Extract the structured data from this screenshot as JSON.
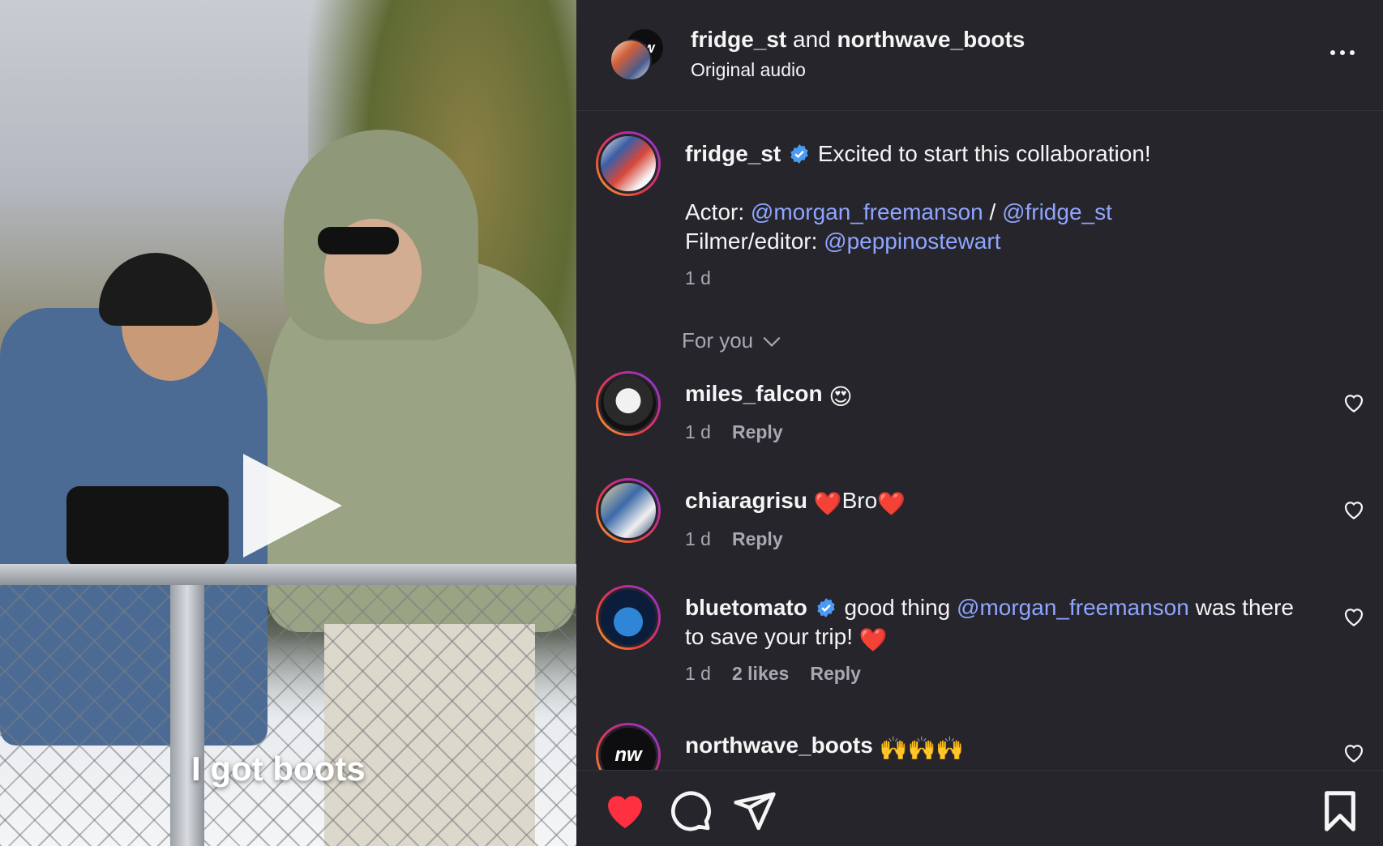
{
  "video": {
    "caption": "I got boots"
  },
  "header": {
    "author1": "fridge_st",
    "conjunction": " and ",
    "author2": "northwave_boots",
    "subtitle": "Original audio",
    "nw_badge": "nw"
  },
  "post": {
    "author": "fridge_st",
    "text": "Excited to start this collaboration!",
    "credit1_label": "Actor: ",
    "credit1_mention_a": "@morgan_freemanson",
    "credit1_sep": " / ",
    "credit1_mention_b": "@fridge_st",
    "credit2_label": "Filmer/editor: ",
    "credit2_mention": "@peppinostewart",
    "time": "1 d"
  },
  "sort": {
    "label": "For you"
  },
  "comments": [
    {
      "username": "miles_falcon",
      "text": "",
      "emoji": "😍",
      "time": "1 d",
      "likes": "",
      "reply": "Reply"
    },
    {
      "username": "chiaragrisu",
      "text": "Bro",
      "emoji": "❤️",
      "time": "1 d",
      "likes": "",
      "reply": "Reply"
    },
    {
      "username": "bluetomato",
      "text_before": "good thing ",
      "mention": "@morgan_freemanson",
      "text_after": " was there to save your trip! ",
      "emoji": "❤️",
      "time": "1 d",
      "likes": "2 likes",
      "reply": "Reply"
    },
    {
      "username": "northwave_boots",
      "emoji": "🙌🙌🙌",
      "avatar_text": "nw"
    }
  ],
  "colors": {
    "panel_bg": "#25252b",
    "mention": "#8fa5ff",
    "like_active": "#ff3040",
    "verified": "#4b9bf5"
  },
  "icons": {
    "like": "heart-filled-icon",
    "comment": "comment-bubble-icon",
    "share": "paper-plane-icon",
    "save": "bookmark-icon",
    "more": "more-dots-icon"
  }
}
